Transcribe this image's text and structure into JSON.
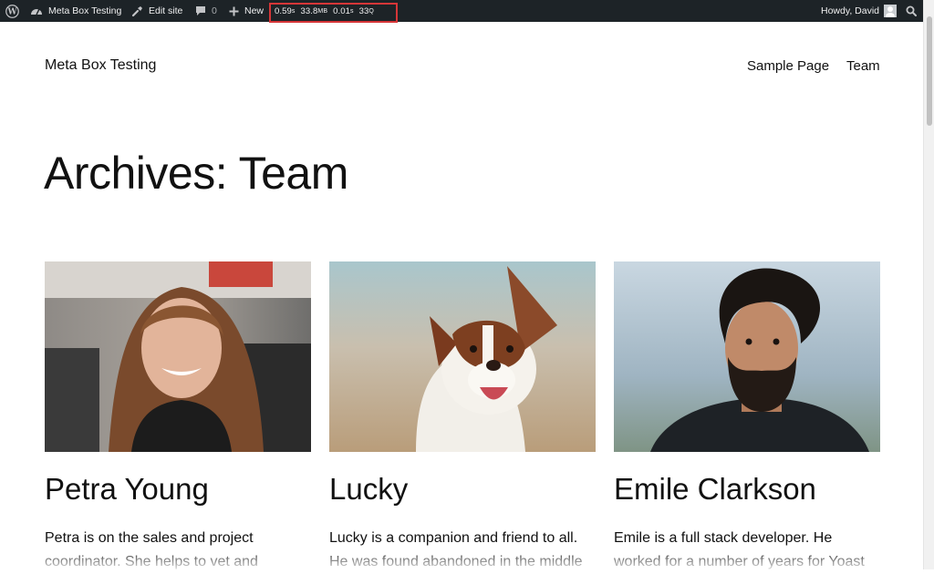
{
  "admin_bar": {
    "site_name": "Meta Box Testing",
    "edit_site": "Edit site",
    "comments_count": "0",
    "new_label": "New",
    "query_monitor": {
      "time": "0.59",
      "memory": "33.8",
      "memory_unit": "MB",
      "query_time": "0.01",
      "queries": "33",
      "queries_unit": "Q"
    },
    "greeting": "Howdy, David"
  },
  "site": {
    "title": "Meta Box Testing"
  },
  "nav": {
    "items": [
      "Sample Page",
      "Team"
    ]
  },
  "archive": {
    "title": "Archives: Team"
  },
  "team": [
    {
      "name": "Petra Young",
      "bio": "Petra is on the sales and project coordinator. She helps to vet and"
    },
    {
      "name": "Lucky",
      "bio": "Lucky is a companion and friend to all. He was found abandoned in the middle"
    },
    {
      "name": "Emile Clarkson",
      "bio": "Emile is a full stack developer. He worked for a number of years for Yoast"
    }
  ],
  "colors": {
    "admin_bar": "#1d2327",
    "highlight_border": "#d63638"
  }
}
